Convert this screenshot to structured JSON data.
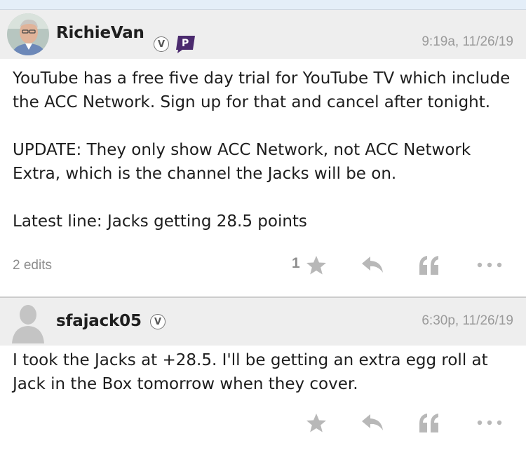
{
  "posts": [
    {
      "username": "RichieVan",
      "verified_badge": "V",
      "premium_badge": "P",
      "timestamp": "9:19a, 11/26/19",
      "body": [
        "YouTube has a free five day trial for YouTube TV which include the ACC Network. Sign up for that and cancel after tonight.",
        "UPDATE: They only show ACC Network, not ACC Network Extra, which is the channel the Jacks will be on.",
        "Latest line: Jacks getting 28.5 points"
      ],
      "edits_label": "2 edits",
      "star_count": "1"
    },
    {
      "username": "sfajack05",
      "verified_badge": "V",
      "timestamp": "6:30p, 11/26/19",
      "body": [
        "I took the Jacks at +28.5. I'll be getting an extra egg roll at Jack in the Box tomorrow when they cover."
      ]
    }
  ],
  "colors": {
    "header_bg": "#eeeeee",
    "premium_purple": "#4b2a6e",
    "icon_gray": "#b8b8b8"
  }
}
